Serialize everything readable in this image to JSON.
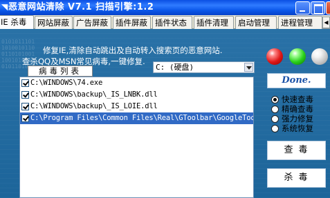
{
  "window": {
    "title": "恶意网站清除 V7.1 扫描引擎:1.2"
  },
  "tabs": [
    {
      "label": "IE 杀毒",
      "active": true
    },
    {
      "label": "网站屏蔽",
      "active": false
    },
    {
      "label": "广告屏蔽",
      "active": false
    },
    {
      "label": "插件屏蔽",
      "active": false
    },
    {
      "label": "插件状态",
      "active": false
    },
    {
      "label": "插件清理",
      "active": false
    },
    {
      "label": "启动管理",
      "active": false
    },
    {
      "label": "进程管理",
      "active": false
    }
  ],
  "description": {
    "line1": "修复IE,清除自动跳出及自动转入搜索页的恶意网站.",
    "line2": "查杀QQ及MSN常见病毒,一键修复."
  },
  "drive_select": {
    "value": "C: (硬盘)"
  },
  "virus_list": {
    "header": "病毒列表",
    "items": [
      {
        "path": "C:\\WINDOWS\\74.exe",
        "checked": true,
        "selected": false
      },
      {
        "path": "C:\\WINDOWS\\backup\\_IS_LNBK.dll",
        "checked": true,
        "selected": false
      },
      {
        "path": "C:\\WINDOWS\\backup\\_IS_LOIE.dll",
        "checked": true,
        "selected": false
      },
      {
        "path": "C:\\Program Files\\Common Files\\Real\\GToolbar\\GoogleTool",
        "checked": true,
        "selected": true
      }
    ]
  },
  "status": {
    "done_label": "Done."
  },
  "scan_modes": [
    {
      "label": "快速查毒",
      "checked": true
    },
    {
      "label": "精确查毒",
      "checked": false
    },
    {
      "label": "强力修复",
      "checked": false
    },
    {
      "label": "系统恢复",
      "checked": false
    }
  ],
  "buttons": {
    "scan": "查毒",
    "kill": "杀毒"
  },
  "colors": {
    "panel_bg": "#1e6aa2",
    "title_bar": "#0b4fe3",
    "selection": "#316ac5"
  }
}
